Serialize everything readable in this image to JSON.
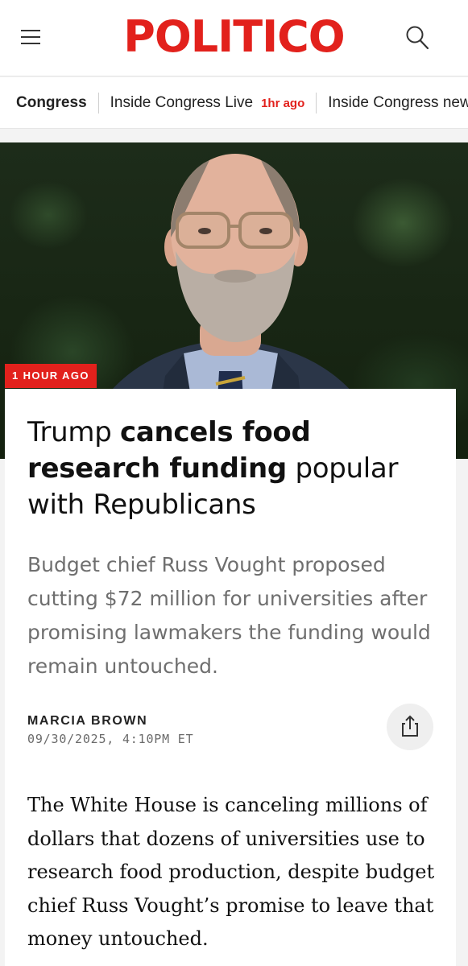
{
  "header": {
    "logo": "POLITICO",
    "menu_icon": "hamburger-menu-icon",
    "search_icon": "search-icon",
    "brand_color": "#e2211c"
  },
  "subnav": {
    "section": "Congress",
    "live_link": "Inside Congress Live",
    "live_time": "1hr ago",
    "news_link": "Inside Congress news"
  },
  "hero": {
    "badge": "1 HOUR AGO"
  },
  "article": {
    "headline_lead": "Trump ",
    "headline_bold": "cancels food research funding",
    "headline_tail": " popular with Republicans",
    "dek": "Budget chief Russ Vought proposed cutting $72 million for universities after promising lawmakers the funding would remain untouched.",
    "author": "MARCIA BROWN",
    "date": "09/30/2025, 4:10PM ET",
    "share_icon": "share-icon",
    "body": "The White House is canceling millions of dollars that dozens of universities use to research food production, despite budget chief Russ Vought’s promise to leave that money untouched."
  }
}
